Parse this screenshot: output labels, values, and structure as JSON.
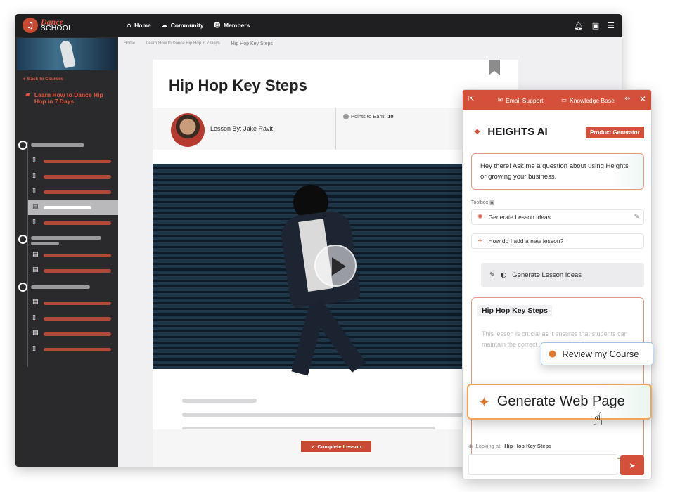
{
  "logo": {
    "line1": "Dance",
    "line2": "SCHOOL",
    "icon": "music-note-icon"
  },
  "nav": [
    {
      "label": "Home",
      "icon": "home-icon",
      "glyph": "⌂"
    },
    {
      "label": "Community",
      "icon": "chat-icon",
      "glyph": "☁"
    },
    {
      "label": "Members",
      "icon": "members-icon",
      "glyph": "☻"
    }
  ],
  "top_icons": [
    "bell-icon",
    "inbox-icon",
    "menu-icon"
  ],
  "sidebar": {
    "back_label": "Back to Courses",
    "course_title": "Learn How to Dance Hip Hop in 7 Days"
  },
  "breadcrumb": {
    "home": "Home",
    "course": "Learn How to Dance Hip Hop in 7 Days",
    "current": "Hip Hop Key Steps"
  },
  "lesson": {
    "title": "Hip Hop Key Steps",
    "lesson_by": "Lesson By: Jake Ravit",
    "points_label": "Points to Earn:",
    "points_value": "10",
    "complete_label": "Complete Lesson"
  },
  "ai_panel": {
    "email_support": "Email Support",
    "knowledge_base": "Knowledge Base",
    "brand": "HEIGHTS AI",
    "badge": "Product Generator",
    "greeting": "Hey there! Ask me a question about using Heights or growing your business.",
    "toolbox_label": "Toolbox",
    "tool_1": "Generate Lesson Ideas",
    "tool_2": "How do I add a new lesson?",
    "generate_button": "Generate Lesson Ideas",
    "card_title": "Hip Hop Key Steps",
    "card_body": "This lesson is crucial as it ensures that students can maintain the correct ... there guitar. Proper",
    "looking_at_label": "Looking at:",
    "looking_at_value": "Hip Hop Key Steps"
  },
  "callouts": {
    "review": "Review my Course",
    "generate_web": "Generate Web Page"
  },
  "colors": {
    "accent": "#d4503a",
    "dark": "#1f1f21",
    "sidebar": "#2a2a2c"
  }
}
